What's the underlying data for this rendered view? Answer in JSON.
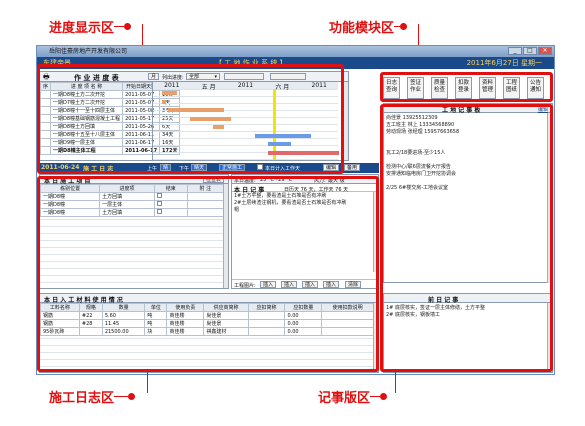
{
  "callouts": {
    "progress": "进度显示区",
    "modules": "功能模块区",
    "daily_log": "施工日志区",
    "notes": "记事版区"
  },
  "window": {
    "title": "岳阳佳豪房地产开发有限公司",
    "company": "东建帝景",
    "system_name": "【 工 地 作 业 系 统 】",
    "date": "2011年6月27日 星期一"
  },
  "progress": {
    "title": "作 业 进 度 表",
    "month_btn": "月",
    "filter_label": "列出进度:",
    "filter_value": "全部",
    "columns": [
      "序",
      "进 度 项 名 称",
      "开始日期天数"
    ],
    "gantt_header": [
      "2011",
      "五 月",
      "2011",
      "六 月",
      "2011"
    ],
    "rows": [
      {
        "name": "一期D8幢土方二次开挖",
        "date": "2011-05-07",
        "days": "10天"
      },
      {
        "name": "一期D7幢土方二次开挖",
        "date": "2011-05-07",
        "days": "0天"
      },
      {
        "name": "一期D8幢十一至十四层主体",
        "date": "2011-05-08",
        "days": "34天"
      },
      {
        "name": "一期D8幢基础钢筋混凝土工程",
        "date": "2011-05-17",
        "days": "25天"
      },
      {
        "name": "一期D8幢土方回填",
        "date": "2011-05-26",
        "days": "6天"
      },
      {
        "name": "一期D8幢十五至十八层主体",
        "date": "2011-06-11",
        "days": "34天"
      },
      {
        "name": "一期D9幢一层主体",
        "date": "2011-06-17",
        "days": "16天"
      },
      {
        "name": "一期D8幢主体工程",
        "date": "2011-06-17",
        "days": "172天"
      }
    ]
  },
  "modules": [
    {
      "line1": "日志",
      "line2": "查询"
    },
    {
      "line1": "签证",
      "line2": "作业"
    },
    {
      "line1": "质量",
      "line2": "检查"
    },
    {
      "line1": "扣款",
      "line2": "登录"
    },
    {
      "line1": "资料",
      "line2": "管理"
    },
    {
      "line1": "工程",
      "line2": "图纸"
    },
    {
      "line1": "公告",
      "line2": "通知"
    }
  ],
  "log_bar": {
    "date": "2011-06-24",
    "title": "施 工 日 志",
    "am_label": "上午",
    "am_value": "晴",
    "pm_label": "下午",
    "pm_value": "晴天",
    "status": "正常施工",
    "checkbox_label": "本日计入工作天",
    "edit_btn": "编辑",
    "prep_btn": "备用"
  },
  "work_items": {
    "title": "本 日 施 工 项 目",
    "check_btn": "检查表",
    "columns": [
      "栋别位置",
      "进度项",
      "结束",
      "附 注"
    ],
    "rows": [
      {
        "loc": "一期D8幢",
        "item": "土方回填"
      },
      {
        "loc": "一期D8幢",
        "item": "一层主体"
      },
      {
        "loc": "一期D8幢",
        "item": "土方回填"
      }
    ]
  },
  "weather": {
    "temp_label": "本日温度:",
    "temp_value": "25° C~29° C",
    "wind_label": "风力:",
    "wind_value": "最大 级"
  },
  "events": {
    "title": "本 日 记 事",
    "stats": "日历天   76 天，工作天   76 天",
    "lines": [
      "1#土方平整，要看渣是土石堆是否有冲刷",
      "2#土层续渣注钢机，要看渣是否土石堆是否有冲刷",
      "帽"
    ],
    "photo_label": "工程图片:",
    "insert_btns": [
      "插入",
      "插入",
      "插入",
      "插入"
    ],
    "clear_btn": "清除"
  },
  "materials": {
    "title": "本 日 入 工 材 料 使 用 情 况",
    "columns": [
      "工料名称",
      "规格",
      "数量",
      "单位",
      "使用负责",
      "供应商简称",
      "应扣简称",
      "应扣数量",
      "使用扣款说明"
    ],
    "rows": [
      {
        "name": "钢筋",
        "spec": "#22",
        "qty": "5.60",
        "unit": "吨",
        "user": "商佳楼",
        "supplier": "尚佳景",
        "deduct": "",
        "dqty": "0.00"
      },
      {
        "name": "钢筋",
        "spec": "#28",
        "qty": "11.45",
        "unit": "吨",
        "user": "商佳楼",
        "supplier": "尚佳景",
        "deduct": "",
        "dqty": "0.00"
      },
      {
        "name": "95砂瓦砖",
        "spec": "",
        "qty": "21500.00",
        "unit": "块",
        "user": "商佳楼",
        "supplier": "祺鑫建材",
        "deduct": "",
        "dqty": "0.00"
      }
    ]
  },
  "board": {
    "title": "工 地 记 事 板",
    "edit_link": "编辑",
    "lines": [
      "尚佳景  13925512309",
      "五工班主 林上  13334568890",
      "劳动现场 张经理  15957663658",
      "",
      "",
      "瓦工2/18要进场-至少15人",
      "",
      "检测中心/联6层流餐大厅报告",
      "安排通知临电房门卫开挖协调会",
      "",
      "2/25 6#楼交房-工地会议室"
    ]
  },
  "todo": {
    "title": "前   日   记   事",
    "lines": [
      "1# 底层核实，签证一层主体修缮，土方平整",
      "2# 底层核实，钢板墙工"
    ]
  }
}
